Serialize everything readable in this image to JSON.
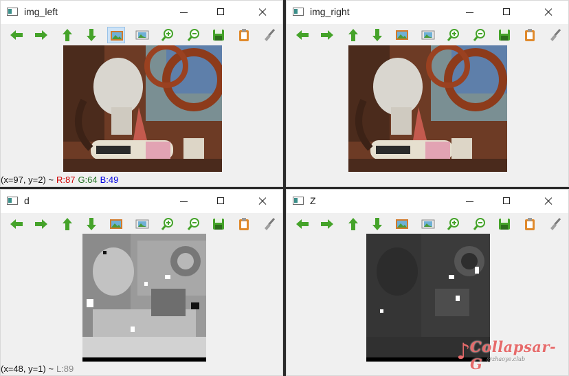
{
  "windows": {
    "img_left": {
      "title": "img_left",
      "status": {
        "coords": "(x=97, y=2) ~",
        "r": "R:87",
        "g": "G:64",
        "b": "B:49"
      }
    },
    "img_right": {
      "title": "img_right"
    },
    "d": {
      "title": "d",
      "status": {
        "coords": "(x=48, y=1) ~",
        "l": "L:89"
      }
    },
    "Z": {
      "title": "Z"
    }
  },
  "toolbar_icons": [
    "arrow-left-icon",
    "arrow-right-icon",
    "arrow-up-icon",
    "arrow-down-icon",
    "fit-image-icon",
    "zoom-area-icon",
    "zoom-in-icon",
    "zoom-out-icon",
    "save-icon",
    "copy-icon",
    "properties-icon"
  ],
  "colors": {
    "red": "#d00000",
    "green": "#207020",
    "blue": "#0000e0",
    "gray": "#888888",
    "icon_green": "#45a32a"
  },
  "watermark": {
    "text": "Collapsar-G",
    "sub": "@zhaoye.club"
  }
}
